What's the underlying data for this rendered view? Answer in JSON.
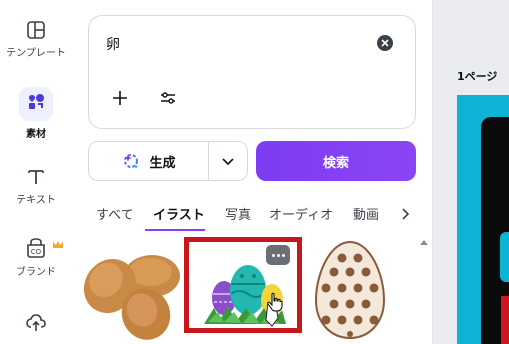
{
  "sidebar": {
    "items": [
      {
        "label": "テンプレート",
        "icon": "template-icon"
      },
      {
        "label": "素材",
        "icon": "elements-icon",
        "active": true
      },
      {
        "label": "テキスト",
        "icon": "text-icon"
      },
      {
        "label": "ブランド",
        "icon": "brand-icon",
        "badge_icon": "crown-icon"
      },
      {
        "label": "",
        "icon": "upload-icon"
      }
    ]
  },
  "search": {
    "value": "卵",
    "clear_icon": "close-icon",
    "add_icon": "plus-icon",
    "filter_icon": "filter-icon"
  },
  "actions": {
    "generate_label": "生成",
    "search_label": "検索"
  },
  "tabs": [
    {
      "label": "すべて"
    },
    {
      "label": "イラスト",
      "active": true
    },
    {
      "label": "写真"
    },
    {
      "label": "オーディオ"
    },
    {
      "label": "動画"
    }
  ],
  "results": [
    {
      "name": "brown-eggs"
    },
    {
      "name": "easter-eggs-on-grass",
      "highlighted": true
    },
    {
      "name": "polka-dot-egg"
    }
  ],
  "editor": {
    "page_label": "1ページ"
  },
  "colors": {
    "accent": "#8b3dff",
    "search_button": "#7d3cf0",
    "highlight_border": "#c8161d",
    "canvas_bg": "#0fb4d4"
  }
}
